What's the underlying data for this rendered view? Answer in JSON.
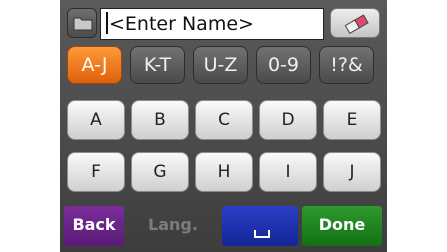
{
  "name_input": {
    "placeholder_text": "<Enter Name>"
  },
  "toolbar": {
    "folder_icon": "folder-icon",
    "erase_icon": "eraser-icon"
  },
  "tabs": [
    {
      "label": "A-J",
      "active": true
    },
    {
      "label": "K-T",
      "active": false
    },
    {
      "label": "U-Z",
      "active": false
    },
    {
      "label": "0-9",
      "active": false
    },
    {
      "label": "!?&",
      "active": false
    }
  ],
  "keys": {
    "row1": [
      "A",
      "B",
      "C",
      "D",
      "E"
    ],
    "row2": [
      "F",
      "G",
      "H",
      "I",
      "J"
    ]
  },
  "bottom_bar": {
    "back_label": "Back",
    "lang_label": "Lang.",
    "space_icon": "space-icon",
    "done_label": "Done"
  },
  "colors": {
    "active_tab": "#f07a1a",
    "back": "#6a2287",
    "space": "#1e31b0",
    "done": "#1f861f"
  }
}
